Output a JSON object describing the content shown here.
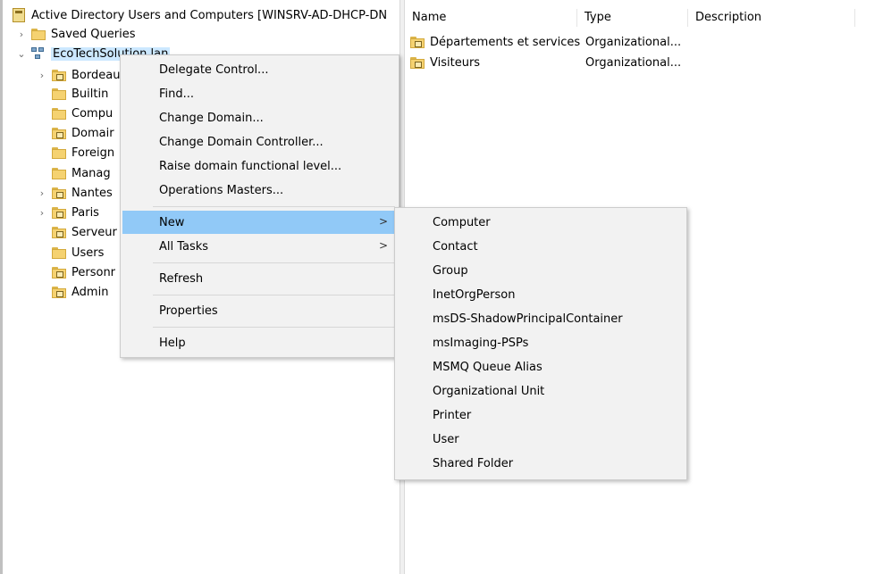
{
  "tree": {
    "root_label": "Active Directory Users and Computers [WINSRV-AD-DHCP-DN",
    "saved_queries": "Saved Queries",
    "domain": "EcoTechSolution.lan",
    "children": [
      "Bordeau",
      "Builtin",
      "Compu",
      "Domair",
      "Foreign",
      "Manag",
      "Nantes",
      "Paris",
      "Serveur",
      "Users",
      "Personr",
      "Admin"
    ]
  },
  "list": {
    "columns": [
      "Name",
      "Type",
      "Description"
    ],
    "rows": [
      {
        "name": "Départements et services",
        "type": "Organizational..."
      },
      {
        "name": "Visiteurs",
        "type": "Organizational..."
      }
    ]
  },
  "context_menu": {
    "items": [
      "Delegate Control...",
      "Find...",
      "Change Domain...",
      "Change Domain Controller...",
      "Raise domain functional level...",
      "Operations Masters...",
      "New",
      "All Tasks",
      "Refresh",
      "Properties",
      "Help"
    ],
    "arrow": ">"
  },
  "submenu": {
    "items": [
      "Computer",
      "Contact",
      "Group",
      "InetOrgPerson",
      "msDS-ShadowPrincipalContainer",
      "msImaging-PSPs",
      "MSMQ Queue Alias",
      "Organizational Unit",
      "Printer",
      "User",
      "Shared Folder"
    ]
  },
  "colors": {
    "highlight": "#91c9f7",
    "selection": "#cce8ff",
    "menu_bg": "#f2f2f2",
    "folder": "#f5d271"
  },
  "icons": {
    "expand": "chevron-right-icon",
    "collapse": "chevron-down-icon",
    "folder": "folder-icon",
    "ou": "organizational-unit-icon",
    "domain": "domain-icon",
    "console": "console-root-icon"
  }
}
